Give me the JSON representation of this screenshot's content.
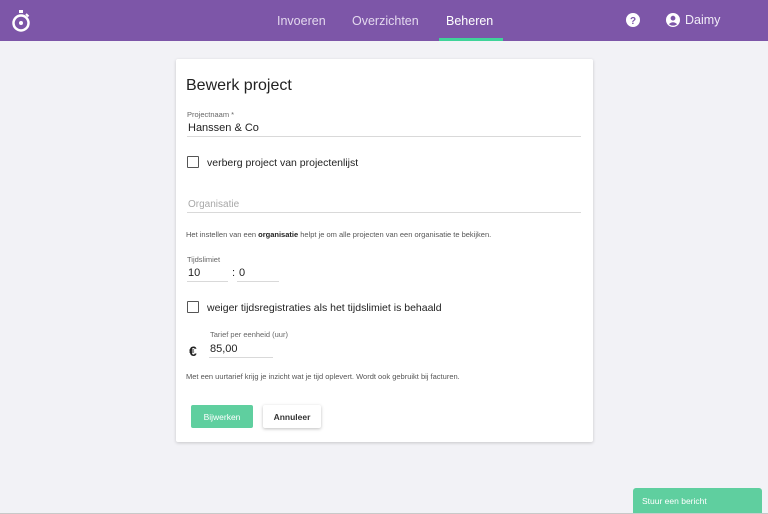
{
  "nav": {
    "items": [
      {
        "label": "Invoeren"
      },
      {
        "label": "Overzichten"
      },
      {
        "label": "Beheren"
      }
    ],
    "user_name": "Daimy"
  },
  "form": {
    "title": "Bewerk project",
    "project_name_label": "Projectnaam *",
    "project_name_value": "Hanssen & Co",
    "hide_label": "verberg project van projectenlijst",
    "hide_checked": false,
    "organisation_placeholder": "Organisatie",
    "organisation_hint_pre": "Het instellen van een ",
    "organisation_hint_bold": "organisatie",
    "organisation_hint_post": " helpt je om alle projecten van een organisatie te bekijken.",
    "time_limit_label": "Tijdslimiet",
    "time_limit_hours": "10",
    "time_separator": ":",
    "time_limit_minutes": "0",
    "refuse_label": "weiger tijdsregistraties als het tijdslimiet is behaald",
    "refuse_checked": false,
    "rate_label": "Tarief per eenheid (uur)",
    "currency_symbol": "€",
    "rate_value": "85,00",
    "rate_hint": "Met een uurtarief krijg je inzicht wat je tijd oplevert. Wordt ook gebruikt bij facturen.",
    "update_label": "Bijwerken",
    "cancel_label": "Annuleer"
  },
  "chat": {
    "label": "Stuur een bericht"
  },
  "colors": {
    "topbar": "#7d56a8",
    "accent": "#5fcf9f",
    "underline": "#3fd39a"
  }
}
